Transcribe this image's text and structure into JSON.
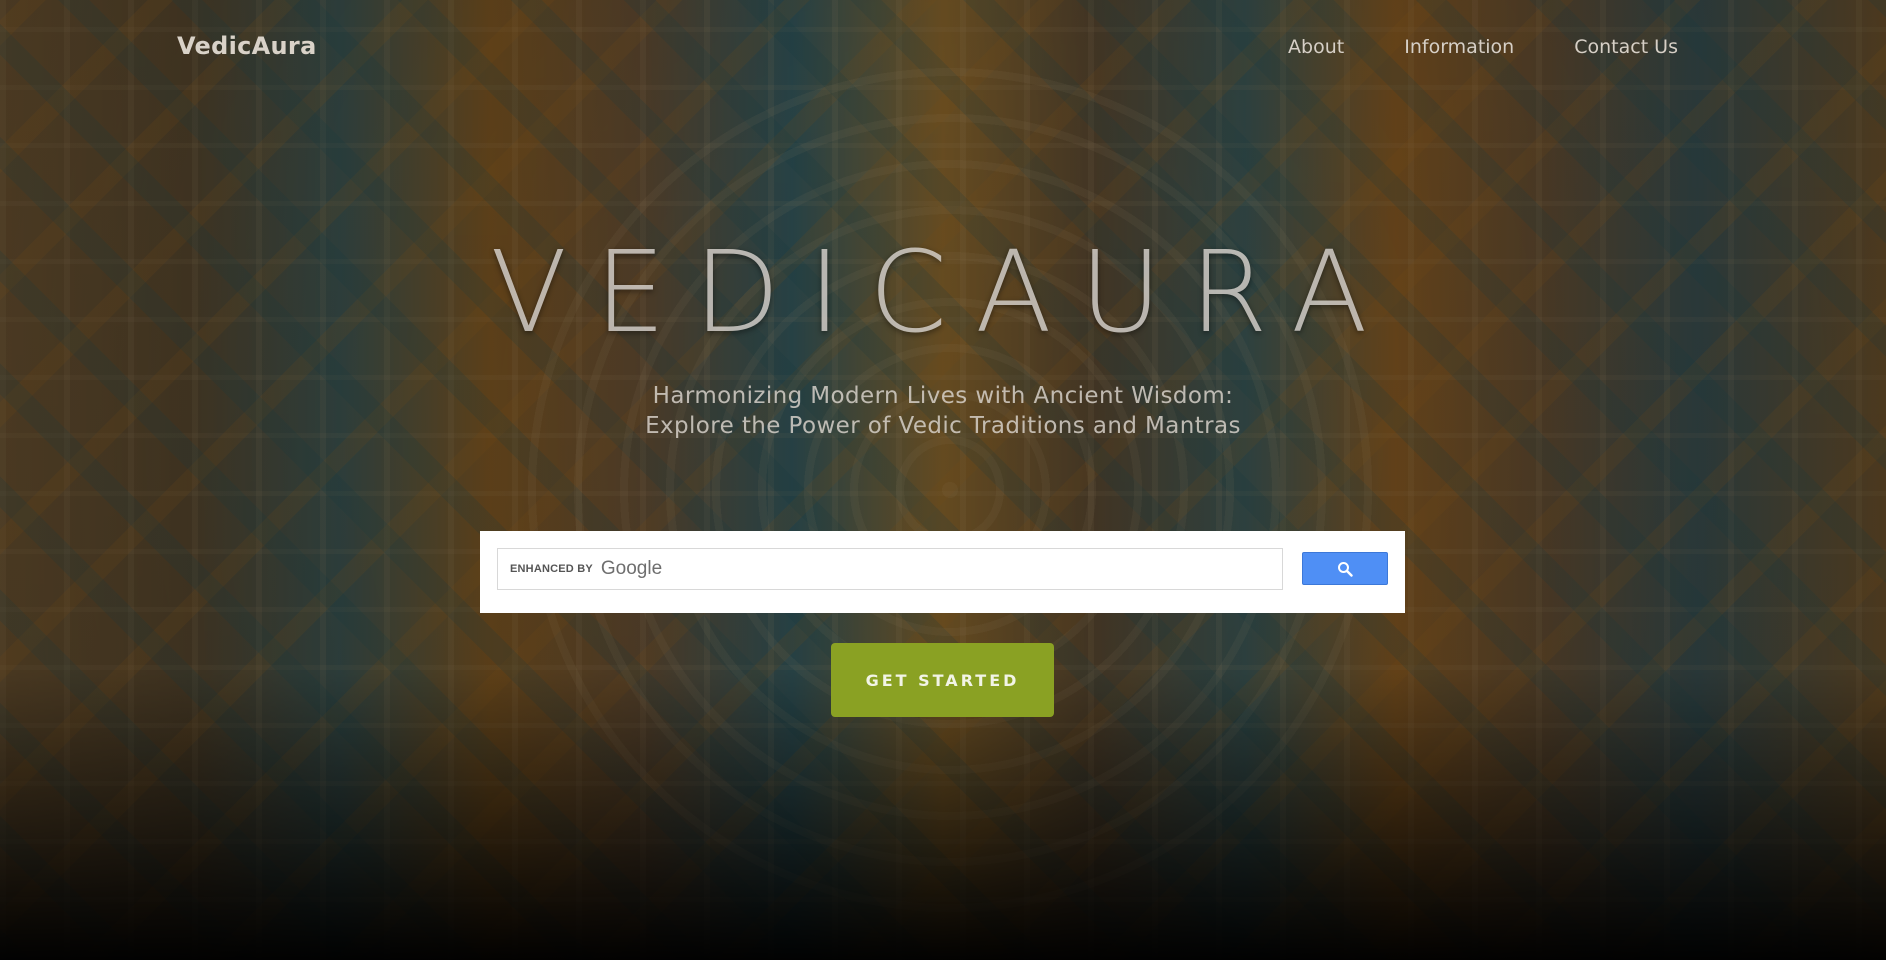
{
  "header": {
    "brand": "VedicAura",
    "nav": [
      {
        "label": "About"
      },
      {
        "label": "Information"
      },
      {
        "label": "Contact Us"
      }
    ]
  },
  "hero": {
    "title": "VEDICAURA",
    "subtitle": "Harmonizing Modern Lives with Ancient Wisdom: Explore the Power of Vedic Traditions and Mantras"
  },
  "search": {
    "enhanced_label": "ENHANCED BY",
    "provider": "Google",
    "value": "",
    "button_color": "#4f8ff5"
  },
  "cta": {
    "label": "GET STARTED",
    "color": "#8aa123"
  }
}
